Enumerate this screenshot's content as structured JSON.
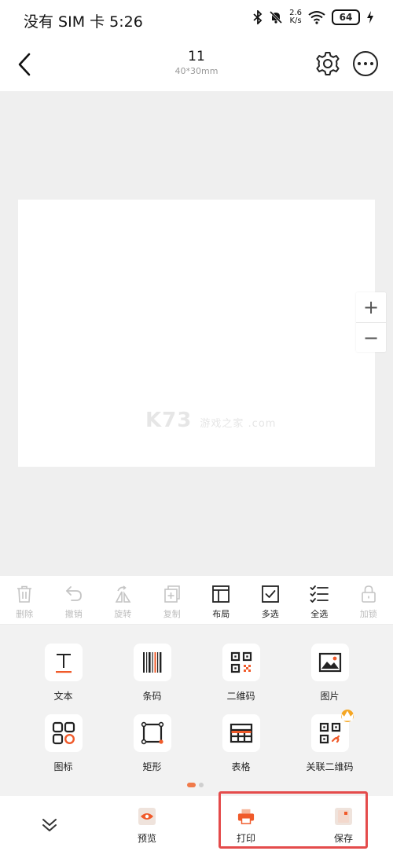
{
  "status_bar": {
    "left_text": "没有 SIM 卡 5:26",
    "net_speed_top": "2.6",
    "net_speed_bottom": "K/s",
    "battery": "64",
    "icons": [
      "bluetooth-icon",
      "mute-icon",
      "wifi-icon",
      "battery-icon",
      "charging-icon"
    ]
  },
  "header": {
    "title": "11",
    "subtitle": "40*30mm",
    "icons": [
      "back-arrow-icon",
      "gear-icon",
      "more-icon"
    ]
  },
  "canvas": {
    "watermark_main": "K73",
    "watermark_small": "游戏之家 .com",
    "zoom_in": "+",
    "zoom_out": "−"
  },
  "edit_toolbar": {
    "items": [
      {
        "label": "删除",
        "icon": "trash-icon",
        "enabled": false
      },
      {
        "label": "撤销",
        "icon": "undo-icon",
        "enabled": false
      },
      {
        "label": "旋转",
        "icon": "rotate-icon",
        "enabled": false
      },
      {
        "label": "复制",
        "icon": "copy-icon",
        "enabled": false
      },
      {
        "label": "布局",
        "icon": "layout-icon",
        "enabled": true
      },
      {
        "label": "多选",
        "icon": "multi-select-icon",
        "enabled": true
      },
      {
        "label": "全选",
        "icon": "select-all-icon",
        "enabled": true
      },
      {
        "label": "加锁",
        "icon": "lock-icon",
        "enabled": false
      }
    ]
  },
  "elements": {
    "items": [
      {
        "label": "文本",
        "icon": "text-icon"
      },
      {
        "label": "条码",
        "icon": "barcode-icon"
      },
      {
        "label": "二维码",
        "icon": "qrcode-icon"
      },
      {
        "label": "图片",
        "icon": "image-icon"
      },
      {
        "label": "图标",
        "icon": "icon-library-icon"
      },
      {
        "label": "矩形",
        "icon": "rectangle-icon"
      },
      {
        "label": "表格",
        "icon": "table-icon"
      },
      {
        "label": "关联二维码",
        "icon": "linked-qrcode-icon",
        "badge": "crown-icon"
      }
    ]
  },
  "bottom_bar": {
    "collapse_icon": "chevron-double-down-icon",
    "preview_label": "预览",
    "print_label": "打印",
    "save_label": "保存"
  },
  "colors": {
    "accent": "#f05a2a",
    "canvas_bg": "#efefef",
    "panel_bg": "#f2f2f2",
    "disabled": "#bdbdbd",
    "highlight": "#e44b4b"
  }
}
